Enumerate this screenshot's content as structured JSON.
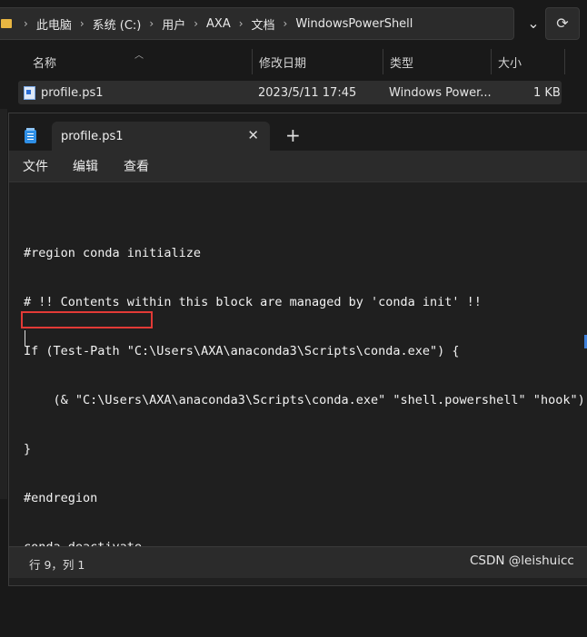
{
  "explorer": {
    "breadcrumb": [
      "此电脑",
      "系统 (C:)",
      "用户",
      "AXA",
      "文档",
      "WindowsPowerShell"
    ],
    "icons": {
      "folder": "folder-icon",
      "chevron": "chevron-down-icon",
      "refresh": "refresh-icon",
      "separator": "chevron-right-icon"
    },
    "columns": {
      "name": "名称",
      "modified": "修改日期",
      "type": "类型",
      "size": "大小"
    },
    "file": {
      "name": "profile.ps1",
      "modified": "2023/5/11 17:45",
      "type": "Windows Power...",
      "size": "1 KB",
      "icon": "powershell-script-icon"
    }
  },
  "notepad": {
    "tab_title": "profile.ps1",
    "tab_close_glyph": "✕",
    "new_tab_glyph": "+",
    "menu": {
      "file": "文件",
      "edit": "编辑",
      "view": "查看"
    },
    "code_lines": [
      "#region conda initialize",
      "# !! Contents within this block are managed by 'conda init' !!",
      "If (Test-Path \"C:\\Users\\AXA\\anaconda3\\Scripts\\conda.exe\") {",
      "    (& \"C:\\Users\\AXA\\anaconda3\\Scripts\\conda.exe\" \"shell.powershell\" \"hook\")",
      "}",
      "#endregion",
      "conda deactivate",
      ""
    ],
    "status": {
      "position": "行 9，列 1"
    },
    "highlight_color": "#e23a36",
    "accent_color": "#3d7fd9"
  },
  "watermark": "CSDN @leishuicc"
}
